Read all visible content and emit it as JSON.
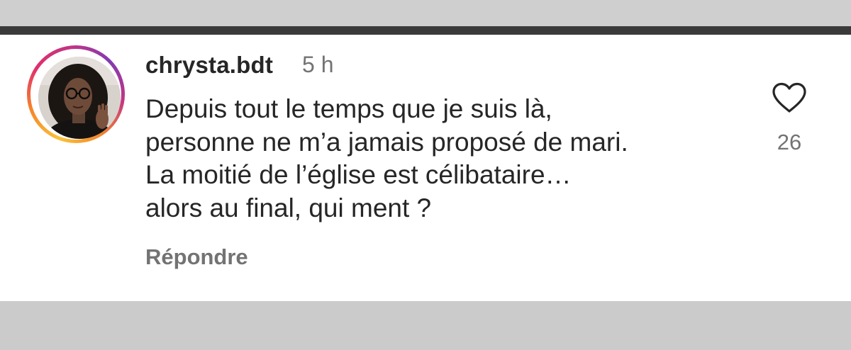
{
  "comment": {
    "username": "chrysta.bdt",
    "timestamp": "5 h",
    "text_lines": [
      "Depuis tout le temps que je suis là,",
      "personne ne m’a jamais proposé de mari.",
      "La moitié de l’église est célibataire…",
      "alors au final, qui ment ?"
    ],
    "reply_label": "Répondre",
    "like_count": "26",
    "like_icon": "heart-icon",
    "avatar_ring_colors": [
      "#f9c33a",
      "#f58529",
      "#e1306c",
      "#c13584",
      "#833ab4"
    ]
  },
  "colors": {
    "text_primary": "#262626",
    "text_secondary": "#737373",
    "card_background": "#ffffff",
    "frame_background": "#cdcdcd",
    "divider_strip": "#3a3a3a"
  }
}
